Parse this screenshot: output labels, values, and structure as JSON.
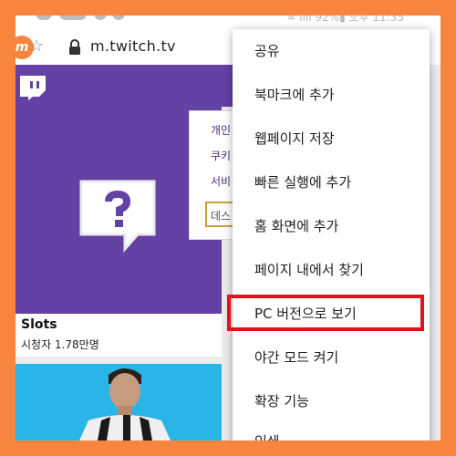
{
  "status_bar": {
    "right_text": "≈ ıııı 92%▮ 오후 11:35"
  },
  "browser": {
    "url": "m.twitch.tv",
    "logo_letter": "m"
  },
  "cards": [
    {
      "title": "Slots",
      "viewers": "시청자 1.78만명"
    }
  ],
  "site_menu": {
    "items": [
      "개인",
      "쿠키",
      "서비"
    ],
    "desktop_label": "데스"
  },
  "overflow_menu": {
    "items": [
      "공유",
      "북마크에 추가",
      "웹페이지 저장",
      "빠른 실행에 추가",
      "홈 화면에 추가",
      "페이지 내에서 찾기",
      "PC 버전으로 보기",
      "야간 모드 켜기",
      "확장 기능",
      "인쇄"
    ],
    "highlighted_index": 6
  },
  "colors": {
    "frame": "#f7853e",
    "twitch_purple": "#6441a4",
    "highlight": "#e3111b"
  }
}
